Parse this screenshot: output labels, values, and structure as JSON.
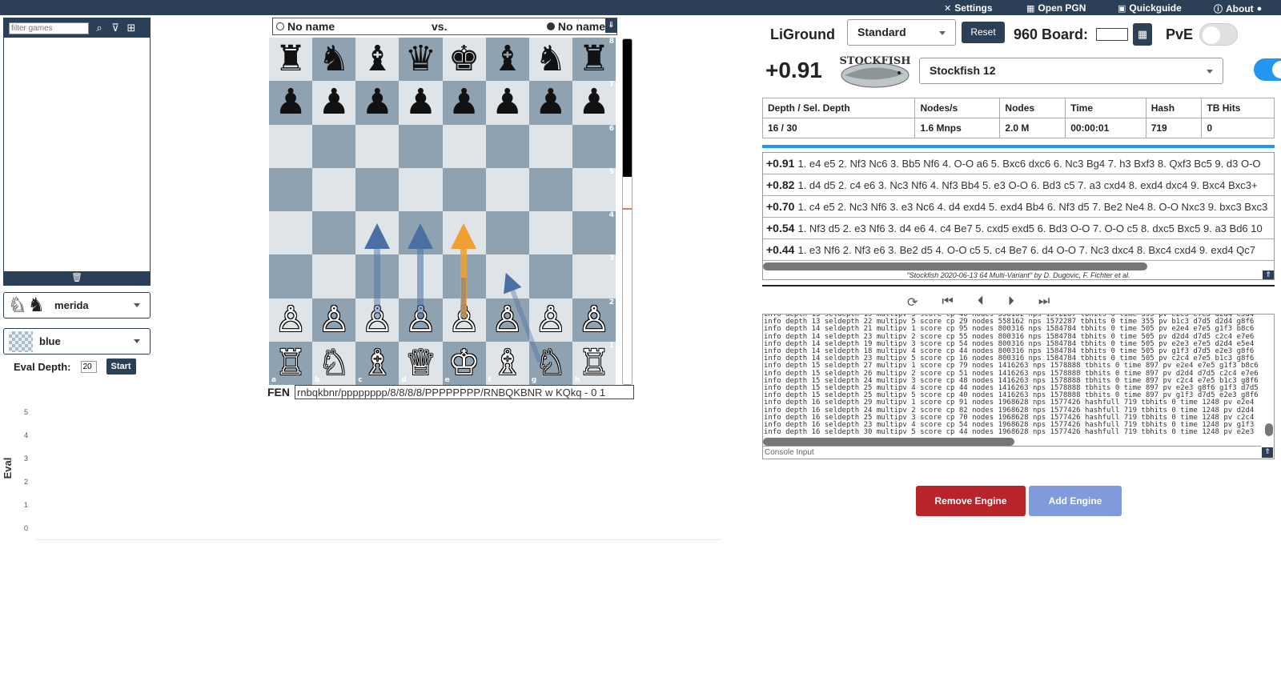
{
  "topbar": {
    "settings": "Settings",
    "open_pgn": "Open PGN",
    "quickguide": "Quickguide",
    "about": "About"
  },
  "gamelist": {
    "filter_placeholder": "filter games"
  },
  "piece_set": "merida",
  "board_theme": "blue",
  "eval_depth": {
    "label": "Eval Depth:",
    "value": "20",
    "start": "Start"
  },
  "eval_chart": {
    "ylabel": "Eval",
    "ticks": [
      "5",
      "4",
      "3",
      "2",
      "1",
      "0"
    ]
  },
  "players": {
    "white": "No name",
    "vs": "vs.",
    "black": "No name"
  },
  "board": {
    "ranks": [
      "8",
      "7",
      "6",
      "5",
      "4",
      "3",
      "2",
      "1"
    ],
    "files": [
      "a",
      "b",
      "c",
      "d",
      "e",
      "f",
      "g",
      "h"
    ],
    "rows": [
      [
        "♜",
        "♞",
        "♝",
        "♛",
        "♚",
        "♝",
        "♞",
        "♜"
      ],
      [
        "♟",
        "♟",
        "♟",
        "♟",
        "♟",
        "♟",
        "♟",
        "♟"
      ],
      [
        "",
        "",
        "",
        "",
        "",
        "",
        "",
        ""
      ],
      [
        "",
        "",
        "",
        "",
        "",
        "",
        "",
        ""
      ],
      [
        "",
        "",
        "",
        "",
        "",
        "",
        "",
        ""
      ],
      [
        "",
        "",
        "",
        "",
        "",
        "",
        "",
        ""
      ],
      [
        "♙",
        "♙",
        "♙",
        "♙",
        "♙",
        "♙",
        "♙",
        "♙"
      ],
      [
        "♖",
        "♘",
        "♗",
        "♕",
        "♔",
        "♗",
        "♘",
        "♖"
      ]
    ],
    "eval_bar_white_fraction": 0.6
  },
  "fen": {
    "label": "FEN",
    "value": "rnbqkbnr/pppppppp/8/8/8/8/PPPPPPPP/RNBQKBNR w KQkq - 0 1"
  },
  "right": {
    "brand": "LiGround",
    "variant": "Standard",
    "reset": "Reset",
    "board960": "960 Board:",
    "pve": "PvE",
    "score": "+0.91",
    "engine": "Stockfish 12",
    "logo_text": "STOCKFISH"
  },
  "stats": {
    "headers": [
      "Depth / Sel. Depth",
      "Nodes/s",
      "Nodes",
      "Time",
      "Hash",
      "TB Hits"
    ],
    "values": [
      "16 / 30",
      "1.6 Mnps",
      "2.0 M",
      "00:00:01",
      "719",
      "0"
    ]
  },
  "pv_lines": [
    {
      "score": "+0.91",
      "moves": "1. e4 e5 2. Nf3 Nc6 3. Bb5 Nf6 4. O-O a6 5. Bxc6 dxc6 6. Nc3 Bg4 7. h3 Bxf3 8. Qxf3 Bc5 9. d3 O-O"
    },
    {
      "score": "+0.82",
      "moves": "1. d4 d5 2. c4 e6 3. Nc3 Nf6 4. Nf3 Bb4 5. e3 O-O 6. Bd3 c5 7. a3 cxd4 8. exd4 dxc4 9. Bxc4 Bxc3+"
    },
    {
      "score": "+0.70",
      "moves": "1. c4 e5 2. Nc3 Nf6 3. e3 Nc6 4. d4 exd4 5. exd4 Bb4 6. Nf3 d5 7. Be2 Ne4 8. O-O Nxc3 9. bxc3 Bxc3"
    },
    {
      "score": "+0.54",
      "moves": "1. Nf3 d5 2. e3 Nf6 3. d4 e6 4. c4 Be7 5. cxd5 exd5 6. Bd3 O-O 7. O-O c5 8. dxc5 Bxc5 9. a3 Bd6 10"
    },
    {
      "score": "+0.44",
      "moves": "1. e3 Nf6 2. Nf3 e6 3. Be2 d5 4. O-O c5 5. c4 Be7 6. d4 O-O 7. Nc3 dxc4 8. Bxc4 cxd4 9. exd4 Qc7"
    }
  ],
  "engine_caption": "\"Stockfish 2020-06-13 64 Multi-Variant\" by D. Dugovic, F. Fichter et al.",
  "console": {
    "lines": [
      "info depth 13 seldepth 19 multipv 5 score cp 40 nodes 558162 nps 1572287 tbhits 0 time 355 pv e2e3 e7e5 d2d4 e5d4",
      "info depth 13 seldepth 22 multipv 5 score cp 29 nodes 558162 nps 1572287 tbhits 0 time 355 pv b1c3 d7d5 d2d4 g8f6",
      "info depth 14 seldepth 21 multipv 1 score cp 95 nodes 800316 nps 1584784 tbhits 0 time 505 pv e2e4 e7e5 g1f3 b8c6",
      "info depth 14 seldepth 23 multipv 2 score cp 55 nodes 800316 nps 1584784 tbhits 0 time 505 pv d2d4 d7d5 c2c4 e7e6",
      "info depth 14 seldepth 19 multipv 3 score cp 54 nodes 800316 nps 1584784 tbhits 0 time 505 pv e2e3 e7e5 d2d4 e5e4",
      "info depth 14 seldepth 18 multipv 4 score cp 44 nodes 800316 nps 1584784 tbhits 0 time 505 pv g1f3 d7d5 e2e3 g8f6",
      "info depth 14 seldepth 23 multipv 5 score cp 16 nodes 800316 nps 1584784 tbhits 0 time 505 pv c2c4 e7e5 b1c3 g8f6",
      "info depth 15 seldepth 27 multipv 1 score cp 79 nodes 1416263 nps 1578888 tbhits 0 time 897 pv e2e4 e7e5 g1f3 b8c6",
      "info depth 15 seldepth 26 multipv 2 score cp 51 nodes 1416263 nps 1578888 tbhits 0 time 897 pv d2d4 d7d5 c2c4 e7e6",
      "info depth 15 seldepth 24 multipv 3 score cp 48 nodes 1416263 nps 1578888 tbhits 0 time 897 pv c2c4 e7e5 b1c3 g8f6",
      "info depth 15 seldepth 25 multipv 4 score cp 44 nodes 1416263 nps 1578888 tbhits 0 time 897 pv e2e3 g8f6 g1f3 d7d5",
      "info depth 15 seldepth 25 multipv 5 score cp 40 nodes 1416263 nps 1578888 tbhits 0 time 897 pv g1f3 d7d5 e2e3 g8f6",
      "info depth 16 seldepth 29 multipv 1 score cp 91 nodes 1968628 nps 1577426 hashfull 719 tbhits 0 time 1248 pv e2e4",
      "info depth 16 seldepth 24 multipv 2 score cp 82 nodes 1968628 nps 1577426 hashfull 719 tbhits 0 time 1248 pv d2d4",
      "info depth 16 seldepth 25 multipv 3 score cp 70 nodes 1968628 nps 1577426 hashfull 719 tbhits 0 time 1248 pv c2c4",
      "info depth 16 seldepth 23 multipv 4 score cp 54 nodes 1968628 nps 1577426 hashfull 719 tbhits 0 time 1248 pv g1f3",
      "info depth 16 seldepth 30 multipv 5 score cp 44 nodes 1968628 nps 1577426 hashfull 719 tbhits 0 time 1248 pv e2e3"
    ],
    "input_placeholder": "Console Input"
  },
  "buttons": {
    "remove_engine": "Remove Engine",
    "add_engine": "Add Engine"
  },
  "colors": {
    "accent": "#2b3f56",
    "light_square": "#dfe4e8",
    "dark_square": "#8fa2b1",
    "remove": "#b7242a",
    "add": "#7f9bdb",
    "toggle_on": "#2196f3"
  }
}
